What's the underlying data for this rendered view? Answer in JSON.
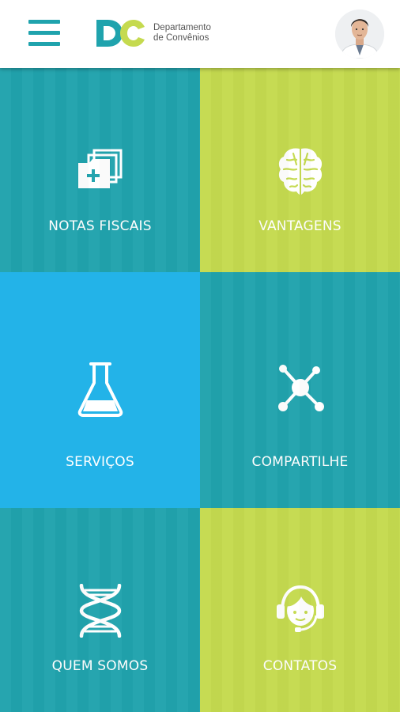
{
  "header": {
    "logo_line1": "Departamento",
    "logo_line2": "de Convênios",
    "colors": {
      "teal": "#1fa3ad",
      "lime": "#c5da4f"
    }
  },
  "tiles": [
    {
      "label": "NOTAS FISCAIS",
      "icon": "folders-medical-icon",
      "color": "#21a3ad"
    },
    {
      "label": "VANTAGENS",
      "icon": "brain-icon",
      "color": "#c5da4f"
    },
    {
      "label": "SERVIÇOS",
      "icon": "flask-icon",
      "color": "#23b3e8"
    },
    {
      "label": "COMPARTILHE",
      "icon": "share-network-icon",
      "color": "#21a3ad"
    },
    {
      "label": "QUEM SOMOS",
      "icon": "dna-icon",
      "color": "#21a3ad"
    },
    {
      "label": "CONTATOS",
      "icon": "headset-support-icon",
      "color": "#c5da4f"
    }
  ]
}
